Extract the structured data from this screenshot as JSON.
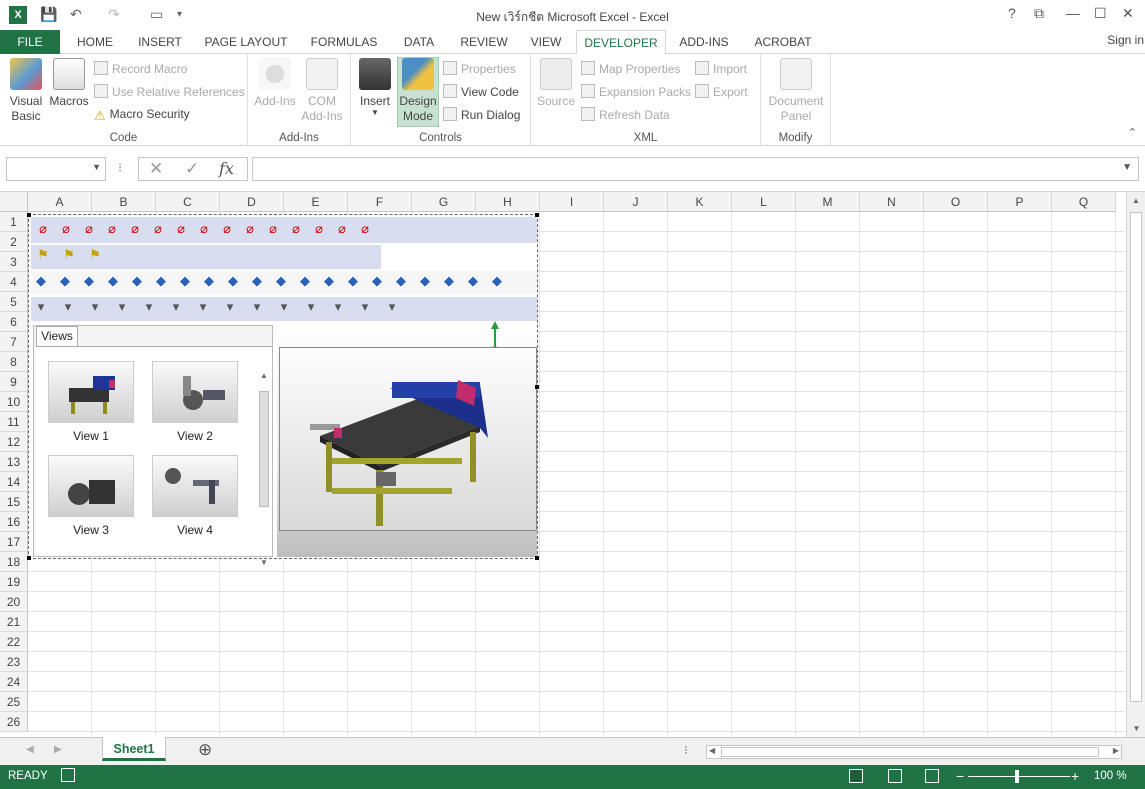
{
  "window": {
    "title": "New เวิร์กชีต Microsoft Excel - Excel",
    "app_icon": "X",
    "help": "?",
    "restore": "⧉",
    "minimize": "—",
    "maximize": "☐",
    "close": "✕"
  },
  "qat": {
    "save": "💾",
    "undo": "↶",
    "redo": "↷",
    "touch": "▭",
    "more": "▾"
  },
  "tabs": [
    "FILE",
    "HOME",
    "INSERT",
    "PAGE LAYOUT",
    "FORMULAS",
    "DATA",
    "REVIEW",
    "VIEW",
    "DEVELOPER",
    "ADD-INS",
    "ACROBAT"
  ],
  "signin": "Sign in",
  "ribbon": {
    "code": {
      "label": "Code",
      "visual_basic": "Visual\nBasic",
      "macros": "Macros",
      "record_macro": "Record Macro",
      "use_relative": "Use Relative References",
      "macro_security": "Macro Security"
    },
    "addins": {
      "label": "Add-Ins",
      "addins": "Add-Ins",
      "com": "COM\nAdd-Ins"
    },
    "controls": {
      "label": "Controls",
      "insert": "Insert",
      "design_mode": "Design\nMode",
      "properties": "Properties",
      "view_code": "View Code",
      "run_dialog": "Run Dialog"
    },
    "xml": {
      "label": "XML",
      "source": "Source",
      "map_properties": "Map Properties",
      "expansion_packs": "Expansion Packs",
      "refresh_data": "Refresh Data",
      "import": "Import",
      "export": "Export"
    },
    "modify": {
      "label": "Modify",
      "document_panel": "Document\nPanel"
    }
  },
  "formula_bar": {
    "name_box": "",
    "fx": "fx",
    "cancel": "✕",
    "enter": "✓",
    "formula": ""
  },
  "columns": [
    "A",
    "B",
    "C",
    "D",
    "E",
    "F",
    "G",
    "H",
    "I",
    "J",
    "K",
    "L",
    "M",
    "N",
    "O",
    "P",
    "Q"
  ],
  "rows": [
    "1",
    "2",
    "3",
    "4",
    "5",
    "6",
    "7",
    "8",
    "9",
    "10",
    "11",
    "12",
    "13",
    "14",
    "15",
    "16",
    "17",
    "18",
    "19",
    "20",
    "21",
    "22",
    "23",
    "24",
    "25",
    "26"
  ],
  "control": {
    "views_tab": "Views",
    "views": [
      "View 1",
      "View 2",
      "View 3",
      "View 4"
    ]
  },
  "sheet": {
    "tabs": [
      "Sheet1"
    ],
    "add_sheet": "⊕"
  },
  "status": {
    "ready": "READY",
    "zoom": "100 %",
    "zoom_minus": "−",
    "zoom_plus": "+"
  },
  "colors": {
    "accent": "#217346",
    "control_toolbar": "#d8def0"
  }
}
